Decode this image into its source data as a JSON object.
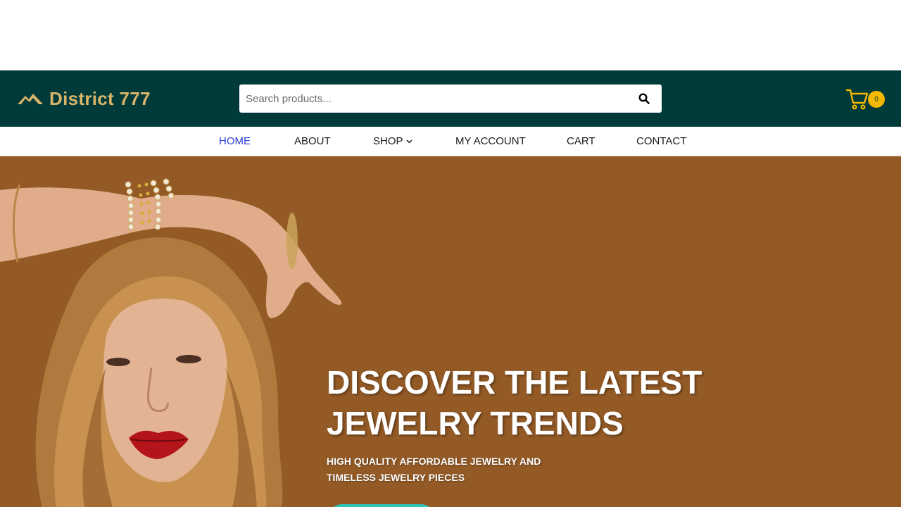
{
  "brand": {
    "name": "District 777",
    "color": "#d9b56a"
  },
  "header": {
    "background": "#003b3a"
  },
  "search": {
    "placeholder": "Search products...",
    "icon": "search-icon"
  },
  "cart": {
    "icon": "cart-icon",
    "count": "0"
  },
  "nav": {
    "items": [
      {
        "label": "HOME",
        "active": true
      },
      {
        "label": "ABOUT"
      },
      {
        "label": "SHOP",
        "icon": "chevron-down-icon"
      },
      {
        "label": "MY ACCOUNT"
      },
      {
        "label": "CART"
      },
      {
        "label": "CONTACT"
      }
    ]
  },
  "hero": {
    "background": "#935a26",
    "title_line1": "DISCOVER THE LATEST",
    "title_line2": "JEWELRY TRENDS",
    "subtitle_line1": "HIGH QUALITY AFFORDABLE JEWELRY AND",
    "subtitle_line2": "TIMELESS JEWELRY PIECES",
    "button_color": "#2ec4b6"
  }
}
